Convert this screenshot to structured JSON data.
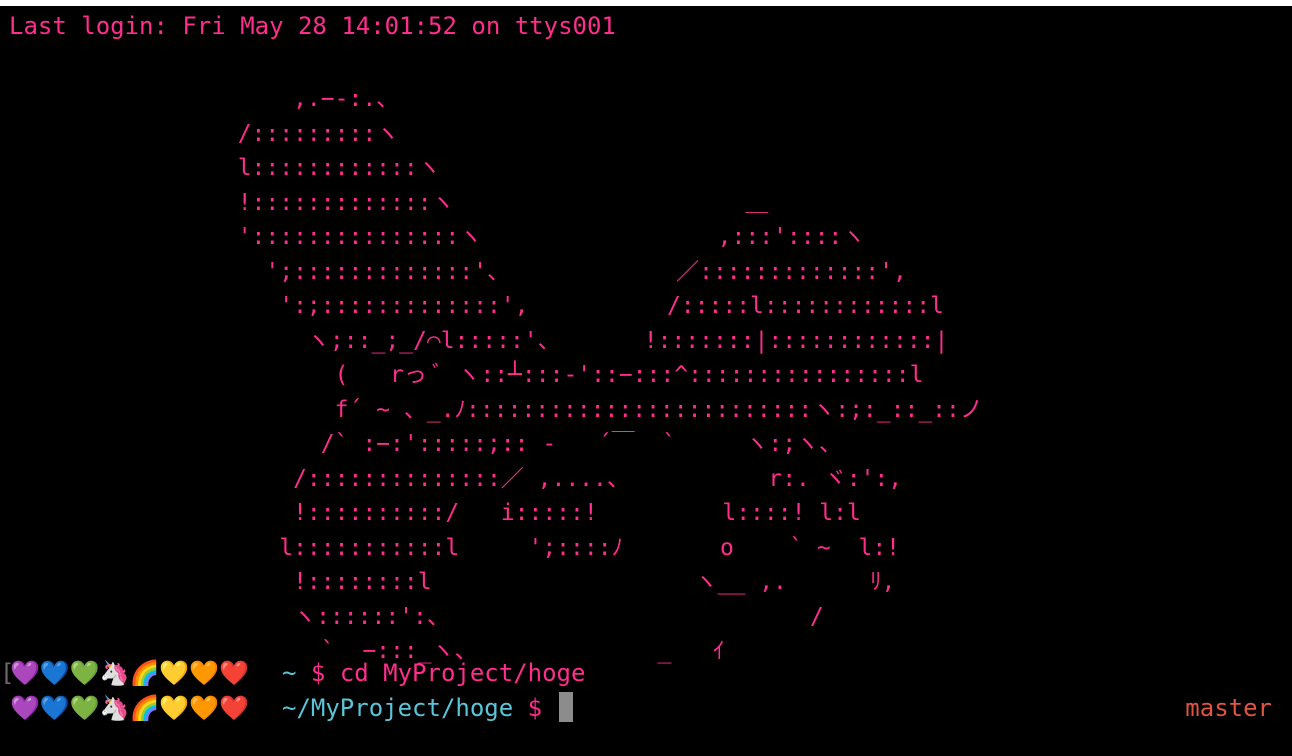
{
  "terminal": {
    "last_login": "Last login: Fri May 28 14:01:52 on ttys001",
    "ascii_art": "      ,.−-:.、\n  /:::::::::ヽ\n  l::::::::::::ヽ\n  !:::::::::::::ヽ                     ＿\n  ':::::::::::::::ヽ                 ,:::'::::ヽ\n    ';:::::::::::::'、            ／:::::::::::::',\n     ':;:::::::::::::',          /:::::l::::::::::::l\n       ヽ;::_;_/⌒l:::::'、      !:::::::|::::::::::::|\n         (   rっ ﾞ ヽ::┴:::-'::−:::^::::::::::::::::l\n         f´ ~ 、_.ﾉ:::::::::::::::::::::::::ヽ:;:_::_::ノ\n        /` :−:':::::;:: -   ´￣  `     ヽ:;ヽ、\n      /::::::::::::::／ ,....、          r:. ヾ:':,\n      !::::::::::/   i:::::!         l::::! l:l\n     l:::::::::::l     ';::::ﾉ       o    ` ~  l:!\n      !::::::::l                   ヽ__ ,.      ﾘ,\n      ヽ::::::':、                          /\n        `  −:::_ヽ、             _   ｲ",
    "prev_prompt": {
      "emoji": "💜💙💚🦄🌈💛🧡❤️",
      "path": "~",
      "dollar": "$",
      "command": "cd MyProject/hoge"
    },
    "current_prompt": {
      "emoji": "💜💙💚🦄🌈💛🧡❤️",
      "path": "~/MyProject/hoge",
      "dollar": "$"
    },
    "git_branch": "master"
  },
  "colors": {
    "background": "#000000",
    "text_pink": "#ff2d8d",
    "path_cyan": "#58c5d8",
    "branch_red": "#e05540",
    "cursor_gray": "#8c8c8c"
  }
}
